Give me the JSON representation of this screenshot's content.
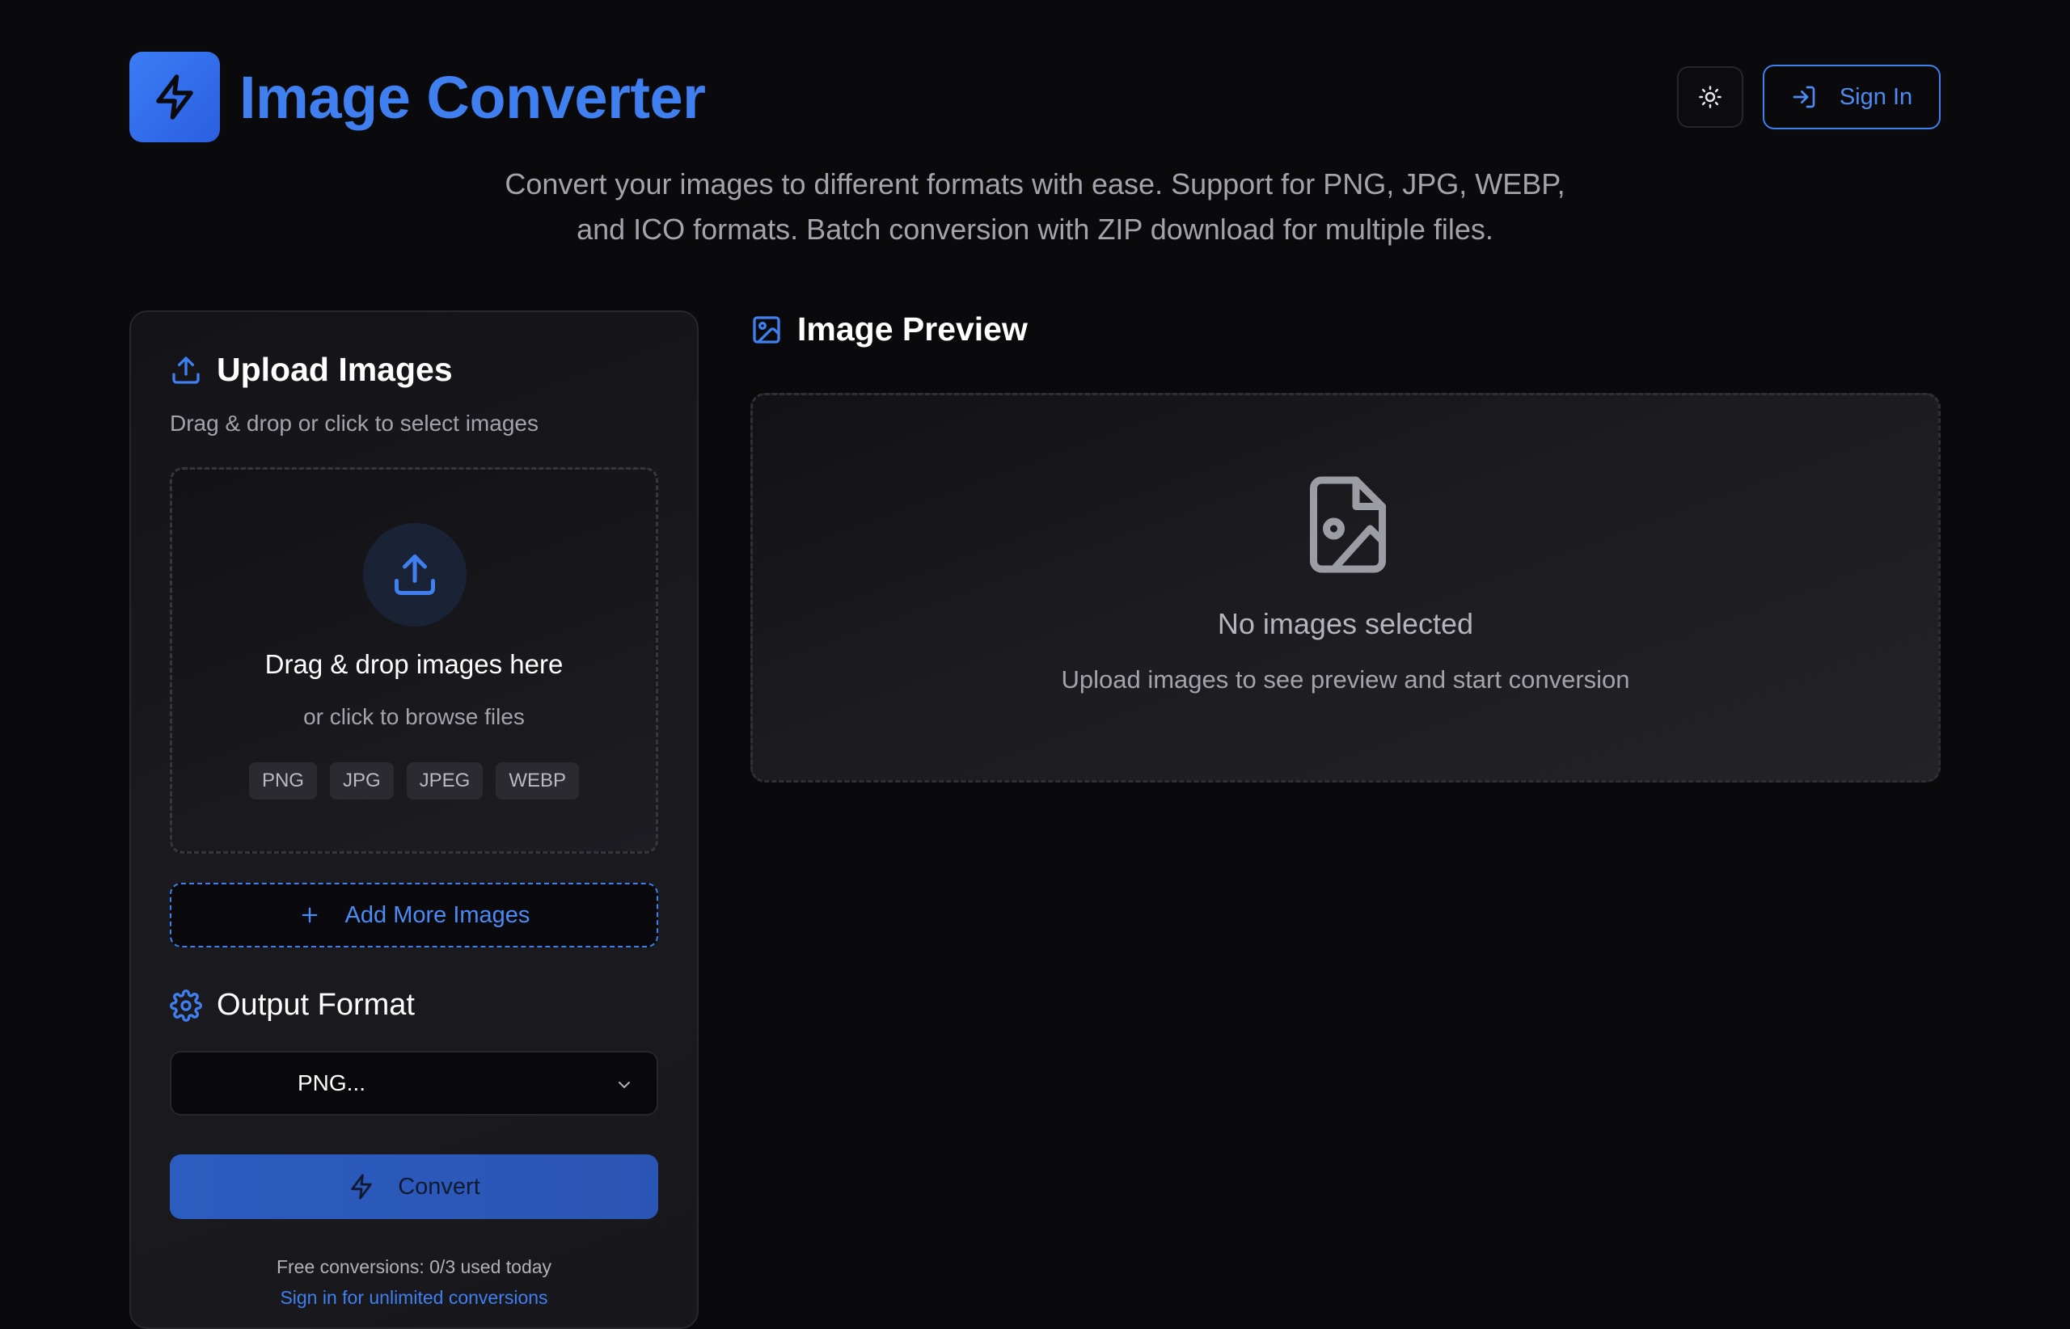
{
  "header": {
    "title": "Image Converter",
    "sign_in_label": "Sign In",
    "logo_icon": "lightning-icon",
    "theme_icon": "sun-icon"
  },
  "subtitle": {
    "line1": "Convert your images to different formats with ease. Support for PNG, JPG, WEBP,",
    "line2": "and ICO formats. Batch conversion with ZIP download for multiple files."
  },
  "upload": {
    "title": "Upload Images",
    "subtitle": "Drag & drop or click to select images",
    "dropzone_title": "Drag & drop images here",
    "dropzone_sub": "or click to browse files",
    "formats": [
      "PNG",
      "JPG",
      "JPEG",
      "WEBP"
    ],
    "add_more_label": "Add More Images"
  },
  "output": {
    "title": "Output Format",
    "selected": "PNG..."
  },
  "convert": {
    "label": "Convert",
    "free_note": "Free conversions: 0/3 used today",
    "upgrade_text": "Sign in for unlimited conversions"
  },
  "preview": {
    "title": "Image Preview",
    "empty_title": "No images selected",
    "empty_sub": "Upload images to see preview and start conversion"
  },
  "colors": {
    "accent": "#3f7ff0",
    "background": "#0a0a0c",
    "panel": "#18181c",
    "muted_text": "#a3a3ab"
  }
}
